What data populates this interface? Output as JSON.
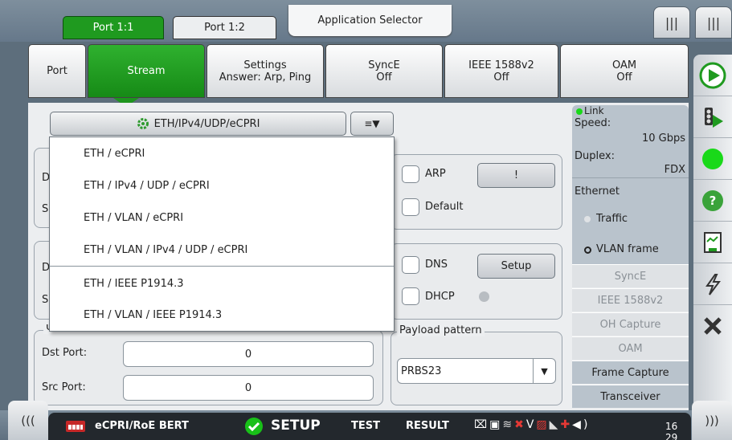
{
  "top": {
    "port_tabs": [
      "Port 1:1",
      "Port 1:2"
    ],
    "app_selector": "Application Selector",
    "menu_icon": "≡"
  },
  "tabs": [
    {
      "label": "Port",
      "sub": ""
    },
    {
      "label": "Stream",
      "sub": ""
    },
    {
      "label": "Settings",
      "sub": "Answer: Arp, Ping"
    },
    {
      "label": "SyncE",
      "sub": "Off"
    },
    {
      "label": "IEEE 1588v2",
      "sub": "Off"
    },
    {
      "label": "OAM",
      "sub": "Off"
    }
  ],
  "dropdown": {
    "selected": "ETH/IPv4/UDP/eCPRI",
    "options": [
      "ETH / eCPRI",
      "ETH / IPv4 / UDP / eCPRI",
      "ETH / VLAN / eCPRI",
      "ETH / VLAN / IPv4 / UDP / eCPRI",
      "ETH / IEEE P1914.3",
      "ETH / VLAN / IEEE P1914.3"
    ]
  },
  "mac": {
    "arp_label": "ARP",
    "arp_button": "!",
    "default_label": "Default"
  },
  "ip": {
    "dns_label": "DNS",
    "setup_button": "Setup",
    "dhcp_label": "DHCP"
  },
  "udp": {
    "legend": "UDP",
    "dst_label": "Dst Port:",
    "dst_value": "0",
    "src_label": "Src Port:",
    "src_value": "0"
  },
  "payload": {
    "legend": "Payload pattern",
    "value": "PRBS23"
  },
  "status": {
    "link": "Link",
    "speed_label": "Speed:",
    "speed_value": "10 Gbps",
    "duplex_label": "Duplex:",
    "duplex_value": "FDX",
    "ethernet": "Ethernet",
    "traffic": "Traffic",
    "vlan_frame": "VLAN frame",
    "rows": [
      "SyncE",
      "IEEE 1588v2",
      "OH Capture",
      "OAM",
      "Frame Capture",
      "Transceiver"
    ]
  },
  "bottom": {
    "app_name": "eCPRI/RoE BERT",
    "setup": "SETUP",
    "test": "TEST",
    "result": "RESULT",
    "time": "16 29",
    "left_arrow": "(((",
    "right_arrow": ")))"
  },
  "colors": {
    "accent_green": "#1f9a1f",
    "panel": "#eceef0"
  }
}
